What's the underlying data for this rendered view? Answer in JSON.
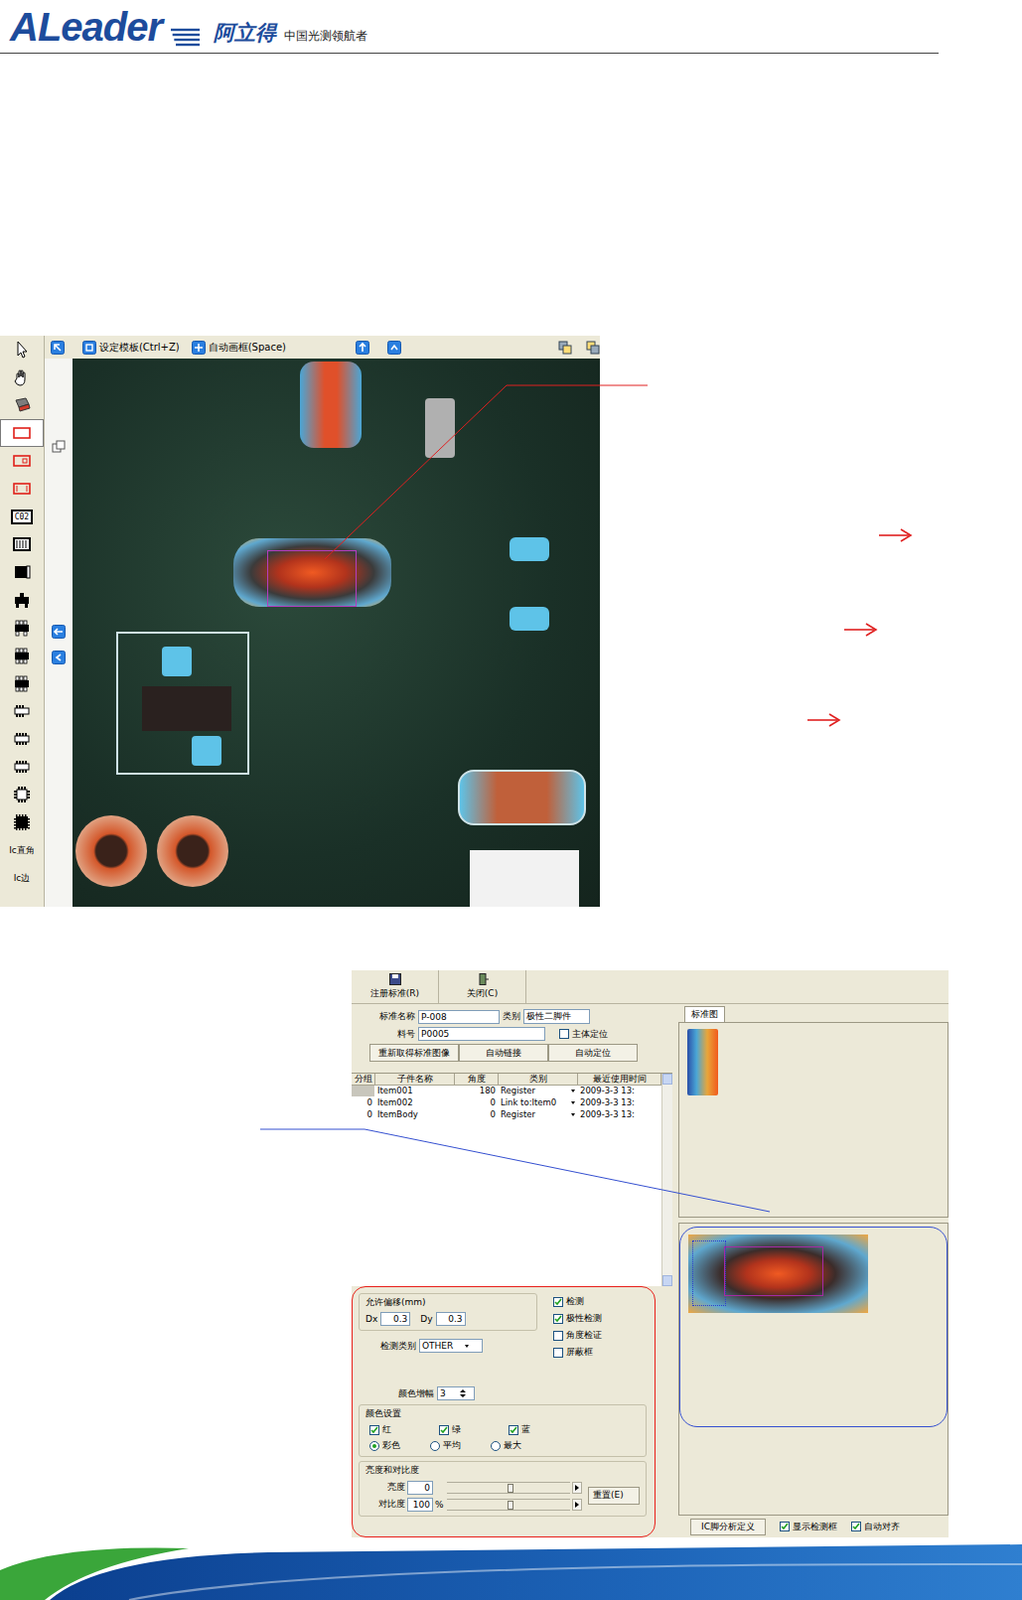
{
  "header": {
    "logo": "ALeader",
    "brand": "阿立得",
    "slogan": "中国光测领航者"
  },
  "editor": {
    "top_buttons": [
      {
        "label": "设定模板(Ctrl+Z)"
      },
      {
        "label": "自动画框(Space)"
      }
    ],
    "tools": [
      {
        "label": "",
        "selected": false
      },
      {
        "label": "",
        "selected": false
      },
      {
        "label": "",
        "selected": false
      },
      {
        "label": "",
        "selected": true
      },
      {
        "label": "",
        "selected": false
      },
      {
        "label": "",
        "selected": false
      },
      {
        "label": "C02",
        "selected": false
      },
      {
        "label": "",
        "selected": false
      },
      {
        "label": "",
        "selected": false
      },
      {
        "label": "",
        "selected": false
      },
      {
        "label": "",
        "selected": false
      },
      {
        "label": "",
        "selected": false
      },
      {
        "label": "",
        "selected": false
      },
      {
        "label": "",
        "selected": false
      },
      {
        "label": "",
        "selected": false
      },
      {
        "label": "",
        "selected": false
      },
      {
        "label": "",
        "selected": false
      },
      {
        "label": "",
        "selected": false
      }
    ],
    "text_tools": [
      {
        "label": "Ic直角",
        "selected": false
      },
      {
        "label": "Ic边",
        "selected": false
      }
    ]
  },
  "dialog": {
    "toolbar": [
      "注册标准(R)",
      "关闭(C)"
    ],
    "name_label": "标准名称",
    "name_value": "P-008",
    "category_label": "类别",
    "category_value": "极性二脚件",
    "part_label": "料号",
    "part_value": "P0005",
    "body_locate": {
      "label": "主体定位",
      "checked": false
    },
    "actions": [
      "重新取得标准图像",
      "自动链接",
      "自动定位"
    ],
    "table": {
      "columns": [
        "分组",
        "子件名称",
        "角度",
        "类别",
        "最近使用时间"
      ],
      "rows": [
        {
          "cells": [
            "",
            "Item001",
            "180",
            "Register",
            "2009-3-3 13:"
          ],
          "selected": true
        },
        {
          "cells": [
            "0",
            "Item002",
            "0",
            "Link to:Item0",
            "2009-3-3 13:"
          ],
          "selected": false
        },
        {
          "cells": [
            "0",
            "ItemBody",
            "0",
            "Register",
            "2009-3-3 13:"
          ],
          "selected": false
        }
      ]
    },
    "settings": {
      "offset": {
        "title": "允许偏移(mm)",
        "dx_label": "Dx",
        "dx": "0.3",
        "dy_label": "Dy",
        "dy": "0.3"
      },
      "checks": [
        {
          "label": "检测",
          "checked": true
        },
        {
          "label": "极性检测",
          "checked": true
        },
        {
          "label": "角度检证",
          "checked": false
        },
        {
          "label": "屏蔽框",
          "checked": false
        }
      ],
      "detect_type": {
        "label": "检测类别",
        "value": "OTHER"
      },
      "gain": {
        "label": "颜色增幅",
        "value": "3"
      },
      "color": {
        "title": "颜色设置",
        "channels": [
          {
            "label": "红",
            "checked": true
          },
          {
            "label": "绿",
            "checked": true
          },
          {
            "label": "蓝",
            "checked": true
          }
        ],
        "modes": [
          {
            "label": "彩色",
            "selected": true
          },
          {
            "label": "平均",
            "selected": false
          },
          {
            "label": "最大",
            "selected": false
          }
        ]
      },
      "brightness": {
        "title": "亮度和对比度",
        "sliders": [
          {
            "label": "亮度",
            "value": "0",
            "unit": "",
            "level": 0.52
          },
          {
            "label": "对比度",
            "value": "100",
            "unit": "%",
            "level": 0.52
          }
        ],
        "reset": "重置(E)"
      }
    },
    "preview": {
      "tab": "标准图",
      "bottom": {
        "button": "IC脚分析定义",
        "checks": [
          {
            "label": "显示检测框",
            "checked": true
          },
          {
            "label": "自动对齐",
            "checked": true
          }
        ]
      }
    }
  }
}
